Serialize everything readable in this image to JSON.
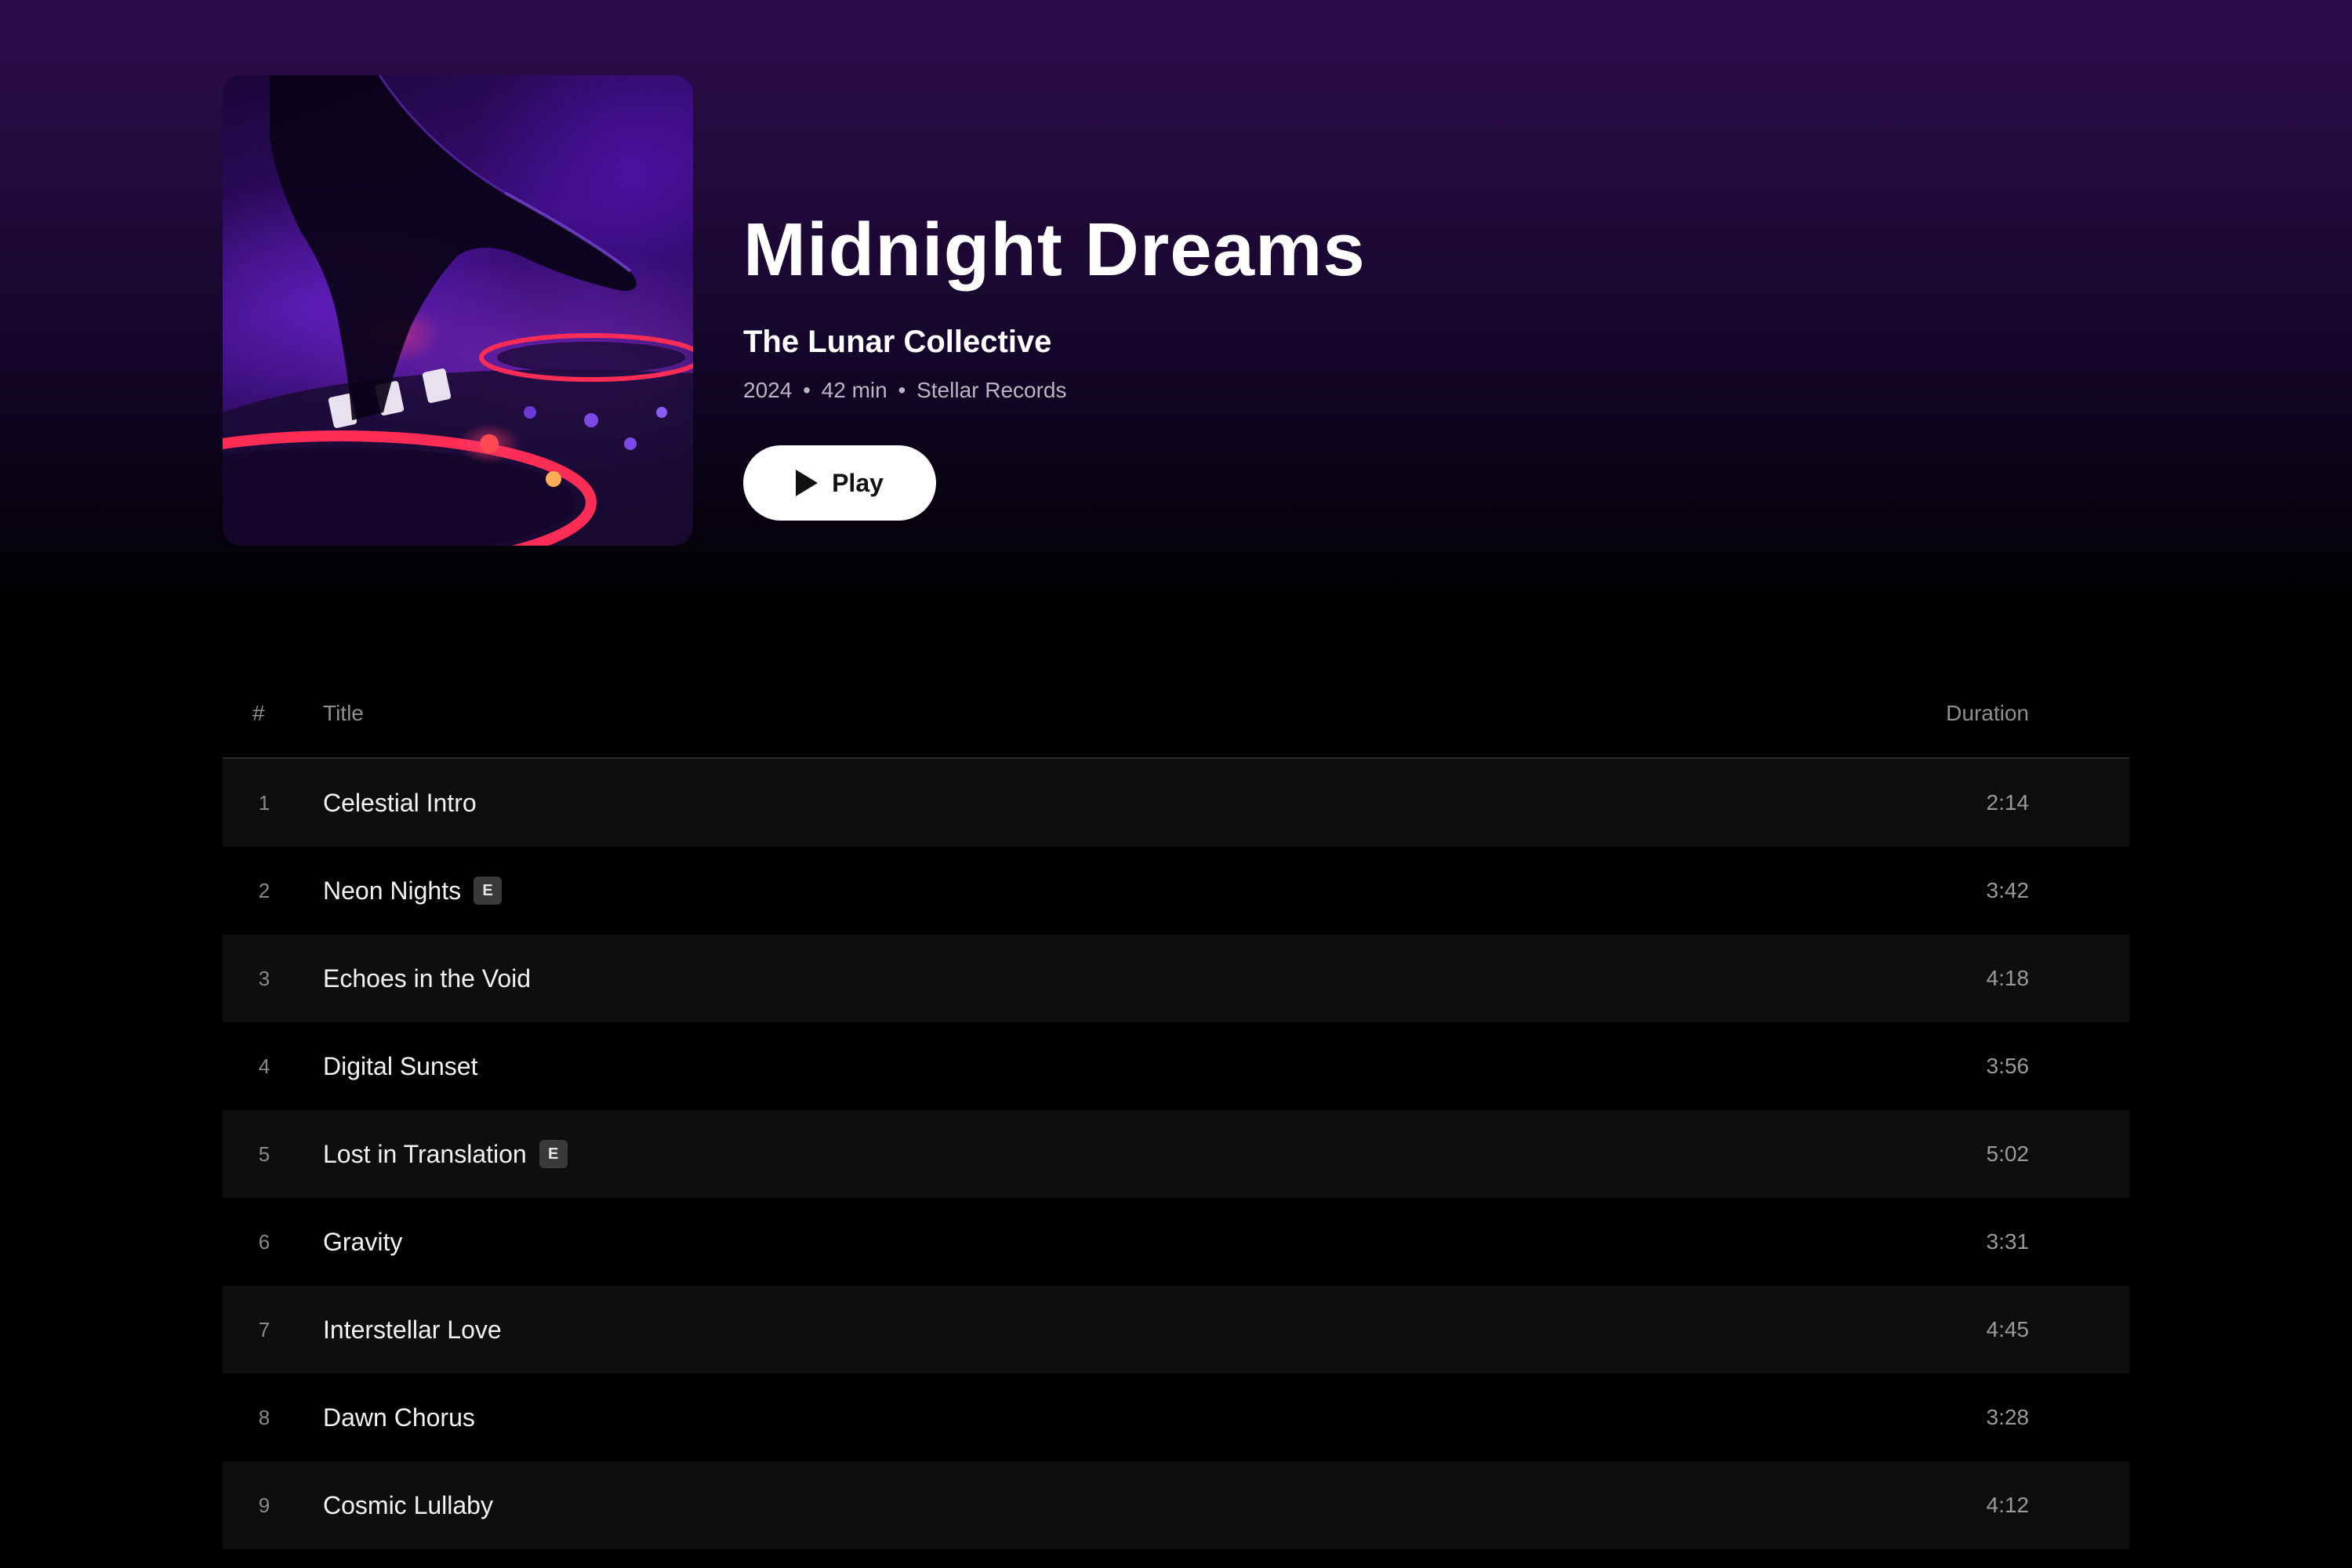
{
  "album": {
    "title": "Midnight Dreams",
    "artist": "The Lunar Collective",
    "year": "2024",
    "length": "42 min",
    "label": "Stellar Records",
    "separator": "•",
    "play_label": "Play",
    "cover_icon": "album-cover-image"
  },
  "tracklist": {
    "header": {
      "number": "#",
      "title": "Title",
      "duration": "Duration"
    },
    "explicit_badge": "E",
    "tracks": [
      {
        "number": "1",
        "title": "Celestial Intro",
        "duration": "2:14",
        "explicit": false
      },
      {
        "number": "2",
        "title": "Neon Nights",
        "duration": "3:42",
        "explicit": true
      },
      {
        "number": "3",
        "title": "Echoes in the Void",
        "duration": "4:18",
        "explicit": false
      },
      {
        "number": "4",
        "title": "Digital Sunset",
        "duration": "3:56",
        "explicit": false
      },
      {
        "number": "5",
        "title": "Lost in Translation",
        "duration": "5:02",
        "explicit": true
      },
      {
        "number": "6",
        "title": "Gravity",
        "duration": "3:31",
        "explicit": false
      },
      {
        "number": "7",
        "title": "Interstellar Love",
        "duration": "4:45",
        "explicit": false
      },
      {
        "number": "8",
        "title": "Dawn Chorus",
        "duration": "3:28",
        "explicit": false
      },
      {
        "number": "9",
        "title": "Cosmic Lullaby",
        "duration": "4:12",
        "explicit": false
      }
    ]
  },
  "colors": {
    "background": "#000000",
    "hero_top": "#2d0c4d",
    "row_alt": "#0e0e0e",
    "button_bg": "#ffffff"
  }
}
